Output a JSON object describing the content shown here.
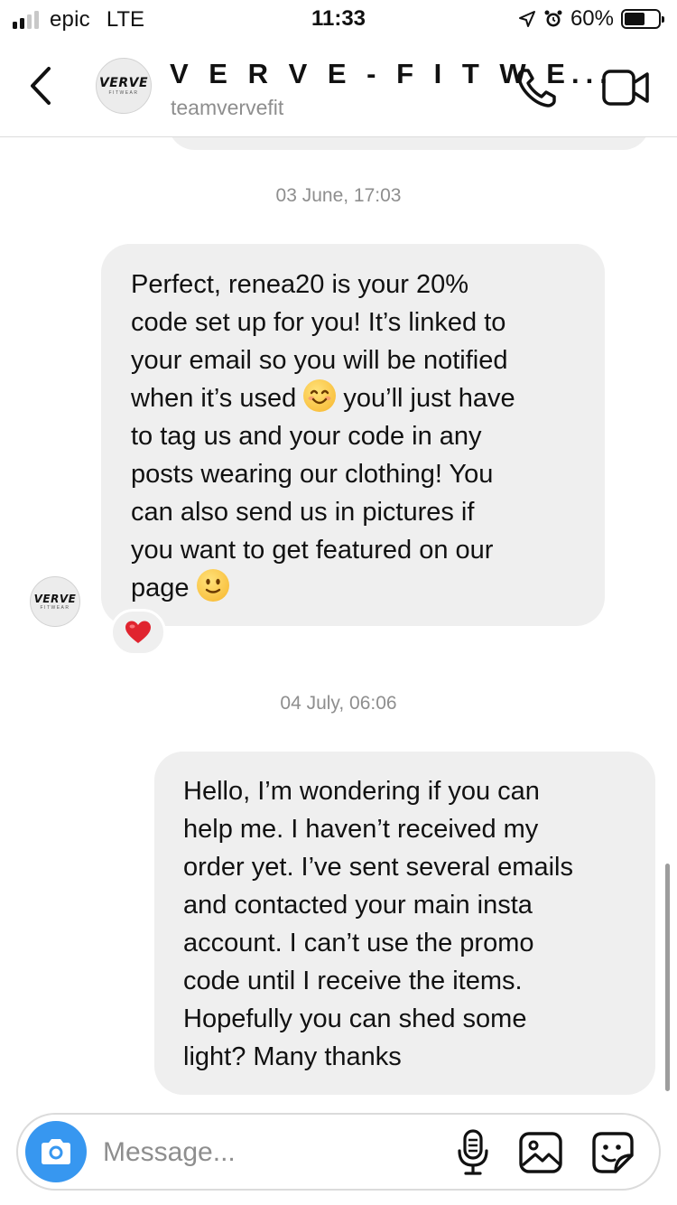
{
  "status_bar": {
    "carrier": "epic",
    "network": "LTE",
    "time": "11:33",
    "battery": "60%",
    "battery_level": 0.6,
    "signal_bars": 2
  },
  "header": {
    "name": "V E R V E - F I T W E...",
    "handle": "teamvervefit",
    "avatar_text": "VERVE",
    "avatar_sub": "FITWEAR"
  },
  "messages": [
    {
      "timestamp": "03 June, 17:03",
      "direction": "incoming",
      "lines": [
        "Perfect, renea20 is your 20%",
        "code set up for you! It’s linked to",
        "your email so you will be notified",
        "when it’s used ",
        " you’ll just have",
        "to tag us and your code in any",
        "posts wearing our clothing! You",
        "can also send us in pictures if",
        "you want to get featured on our",
        "page "
      ],
      "emojis": [
        "smiling-face-with-smiling-eyes",
        "slightly-smiling-face"
      ],
      "reaction": "red-heart"
    },
    {
      "timestamp": "04 July, 06:06",
      "direction": "outgoing",
      "lines": [
        "Hello, I’m wondering if you can",
        "help me. I haven’t received my",
        "order yet. I’ve sent several emails",
        "and contacted your main insta",
        "account. I can’t use the promo",
        "code until I receive the items.",
        "Hopefully you can shed some",
        "light? Many thanks"
      ]
    }
  ],
  "composer": {
    "placeholder": "Message...",
    "value": ""
  },
  "colors": {
    "accent": "#3797f0",
    "bubble": "#efefef",
    "muted_text": "#8e8e8e",
    "heart": "#e0242f"
  },
  "icons": [
    "back-chevron-icon",
    "phone-icon",
    "video-camera-icon",
    "camera-icon",
    "microphone-icon",
    "gallery-icon",
    "sticker-icon",
    "heart-icon"
  ]
}
